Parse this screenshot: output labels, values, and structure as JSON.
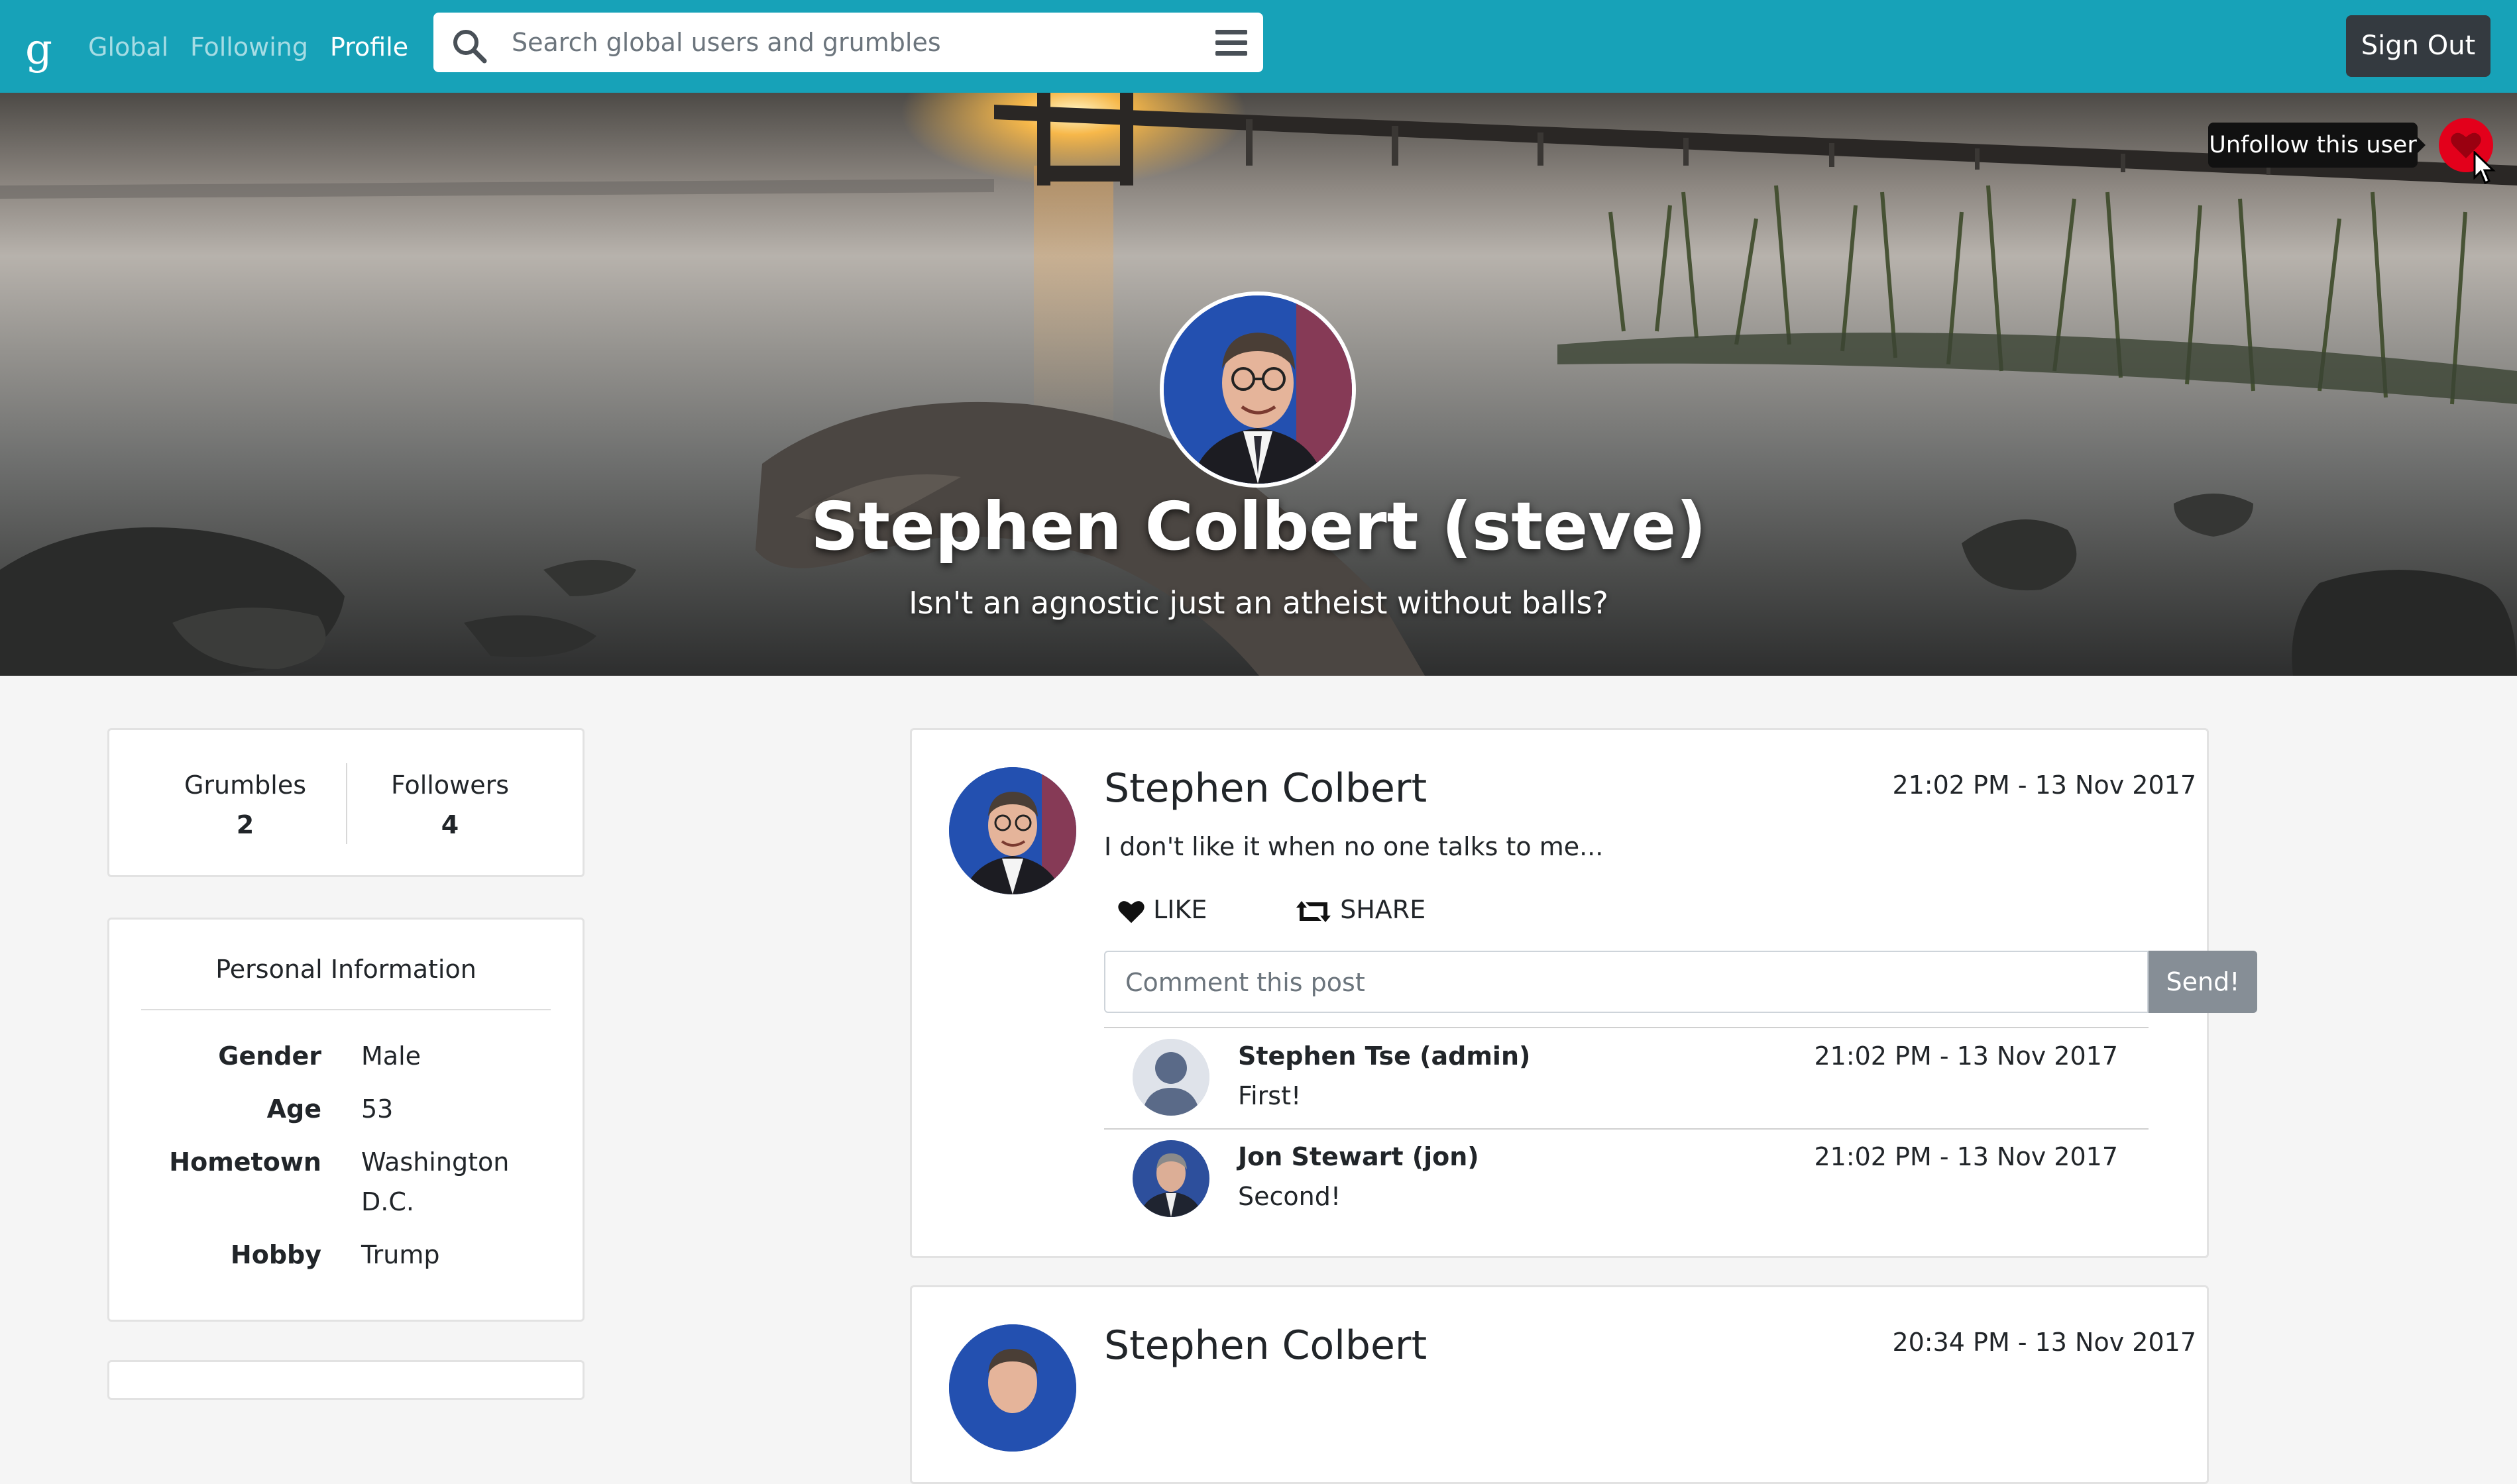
{
  "navbar": {
    "brand": "g",
    "links": [
      {
        "label": "Global",
        "active": false
      },
      {
        "label": "Following",
        "active": false
      },
      {
        "label": "Profile",
        "active": true
      }
    ],
    "search_placeholder": "Search global users and grumbles",
    "search_icon": "search-icon",
    "menu_icon": "hamburger-icon",
    "sign_out_label": "Sign Out",
    "color": "#17a2b8"
  },
  "profile": {
    "name": "Stephen Colbert (steve)",
    "bio": "Isn't an agnostic just an atheist without balls?",
    "follow_tooltip": "Unfollow this user",
    "follow_icon": "heart-icon",
    "follow_color": "#e3001b"
  },
  "stats": {
    "grumbles_label": "Grumbles",
    "grumbles_value": "2",
    "followers_label": "Followers",
    "followers_value": "4"
  },
  "personal_info": {
    "title": "Personal Information",
    "rows": [
      {
        "key": "Gender",
        "value": "Male"
      },
      {
        "key": "Age",
        "value": "53"
      },
      {
        "key": "Hometown",
        "value": "Washington D.C."
      },
      {
        "key": "Hobby",
        "value": "Trump"
      }
    ]
  },
  "posts": [
    {
      "author": "Stephen Colbert",
      "time": "21:02 PM - 13 Nov 2017",
      "text": "I don't like it when no one talks to me...",
      "like_label": "LIKE",
      "share_label": "SHARE",
      "comment_placeholder": "Comment this post",
      "send_label": "Send!",
      "comments": [
        {
          "author": "Stephen Tse (admin)",
          "time": "21:02 PM - 13 Nov 2017",
          "text": "First!"
        },
        {
          "author": "Jon Stewart (jon)",
          "time": "21:02 PM - 13 Nov 2017",
          "text": "Second!"
        }
      ]
    },
    {
      "author": "Stephen Colbert",
      "time": "20:34 PM - 13 Nov 2017"
    }
  ]
}
